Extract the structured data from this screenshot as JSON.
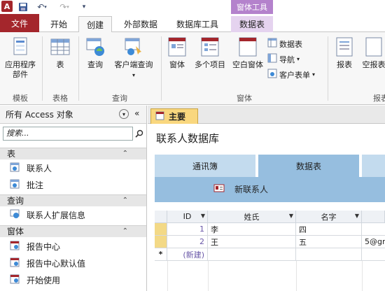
{
  "title_bar": {
    "app_icon": "A",
    "quick_access": [
      "save-icon",
      "undo-icon",
      "redo-icon",
      "customize-icon"
    ],
    "contextual_tools": "窗体工具"
  },
  "tabs": {
    "file": "文件",
    "items": [
      "开始",
      "创建",
      "外部数据",
      "数据库工具",
      "数据表"
    ],
    "active": "创建"
  },
  "ribbon": {
    "templates": {
      "app_parts": "应用程序\n部件",
      "label": "模板"
    },
    "tables": {
      "table": "表",
      "label": "表格"
    },
    "queries": {
      "query": "查询",
      "client_query": "客户端查询",
      "label": "查询"
    },
    "forms": {
      "form": "窗体",
      "multiple_items": "多个项目",
      "blank_form": "空白窗体",
      "datasheet": "数据表",
      "navigation": "导航",
      "client_forms": "客户表单",
      "label": "窗体"
    },
    "reports": {
      "report": "报表",
      "blank_report": "空报表",
      "label": "报表"
    }
  },
  "nav_pane": {
    "header": "所有 Access 对象",
    "search_placeholder": "搜索...",
    "sections": [
      {
        "title": "表",
        "items": [
          "联系人",
          "批注"
        ]
      },
      {
        "title": "查询",
        "items": [
          "联系人扩展信息"
        ]
      },
      {
        "title": "窗体",
        "items": [
          "报告中心",
          "报告中心默认值",
          "开始使用"
        ]
      }
    ]
  },
  "document": {
    "tab_label": "主要",
    "title": "联系人数据库",
    "form_tabs": [
      "通讯簿",
      "数据表"
    ],
    "active_form_tab": "数据表",
    "new_contact": "新联系人",
    "grid": {
      "headers": [
        "ID",
        "姓氏",
        "名字"
      ],
      "rows": [
        {
          "id": "1",
          "last": "李",
          "first": "四",
          "extra": ""
        },
        {
          "id": "2",
          "last": "王",
          "first": "五",
          "extra": "5@gm"
        }
      ],
      "new_row_label": "(新建)"
    }
  }
}
